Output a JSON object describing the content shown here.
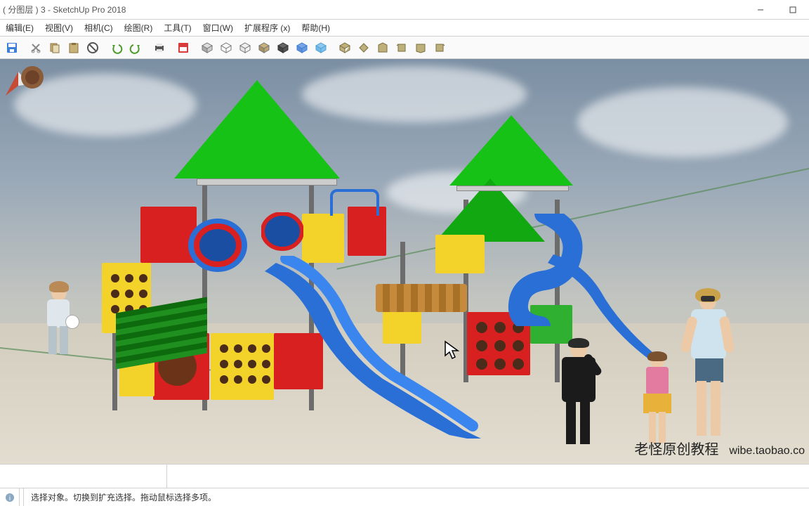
{
  "window": {
    "title": "( 分图层 ) 3 - SketchUp Pro 2018"
  },
  "menu": {
    "edit": "编辑(E)",
    "view": "视图(V)",
    "camera": "相机(C)",
    "draw": "绘图(R)",
    "tools": "工具(T)",
    "window": "窗口(W)",
    "extensions": "扩展程序 (x)",
    "help": "帮助(H)"
  },
  "toolbar": {
    "save": "save-icon",
    "cut": "cut-icon",
    "copy": "copy-icon",
    "paste": "paste-icon",
    "erase": "erase-icon",
    "undo": "undo-icon",
    "redo": "redo-icon",
    "print": "print-icon",
    "model": "model-icon",
    "face1": "face-shaded-icon",
    "face2": "face-wire-icon",
    "face3": "face-hidden-icon",
    "face4": "face-mono-icon",
    "face5": "face-texture-icon",
    "face6": "face-xray-icon",
    "face7": "face-back-icon",
    "iso": "iso-icon",
    "top": "top-icon",
    "front": "front-icon",
    "right": "right-icon",
    "back": "back-icon",
    "left": "left-icon"
  },
  "viewport": {
    "watermark_text": "老怪原创教程",
    "watermark_url": "wibe.taobao.co"
  },
  "statusbar": {
    "hint": "选择对象。切换到扩充选择。拖动鼠标选择多项。"
  }
}
